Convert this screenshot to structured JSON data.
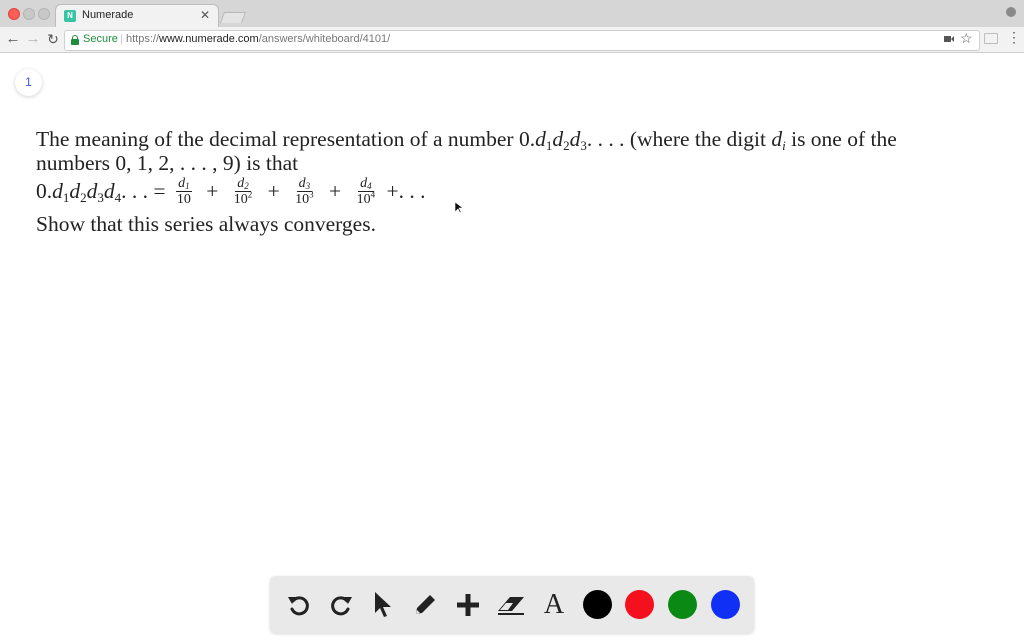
{
  "browser": {
    "tab_title": "Numerade",
    "tab_favicon_letter": "N",
    "secure_label": "Secure",
    "url_scheme": "https://",
    "url_host": "www.numerade.com",
    "url_path": "/answers/whiteboard/4101/"
  },
  "page": {
    "page_number": "1",
    "problem": {
      "intro_text": "The meaning of the decimal representation of a number",
      "where_text": "(where the digit",
      "one_of_text": "is one of the",
      "numbers_text": "numbers 0, 1, 2, . . . , 9) is that",
      "show_text": "Show that this series always converges."
    }
  },
  "whiteboard_toolbar": {
    "tools": [
      "undo-icon",
      "redo-icon",
      "pointer-icon",
      "pencil-icon",
      "plus-icon",
      "eraser-icon",
      "text-icon"
    ],
    "text_tool_label": "A",
    "colors": [
      "#000000",
      "#f5101e",
      "#0a8a15",
      "#1030f5"
    ]
  }
}
